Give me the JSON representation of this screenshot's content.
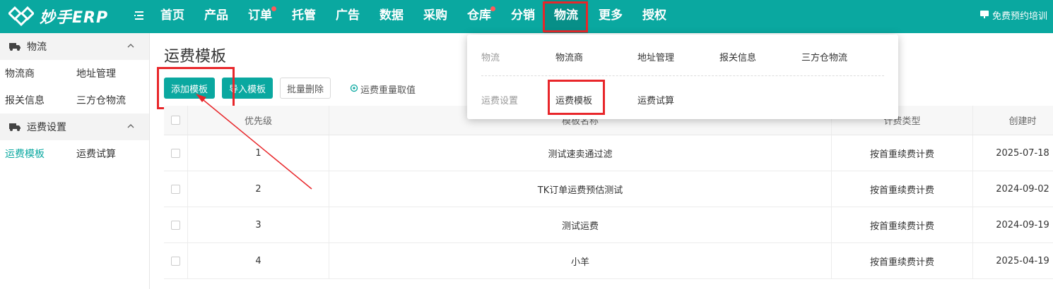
{
  "app": {
    "name": "妙手ERP"
  },
  "nav": {
    "items": [
      {
        "label": "首页",
        "dot": false
      },
      {
        "label": "产品",
        "dot": false
      },
      {
        "label": "订单",
        "dot": true
      },
      {
        "label": "托管",
        "dot": false
      },
      {
        "label": "广告",
        "dot": false
      },
      {
        "label": "数据",
        "dot": false
      },
      {
        "label": "采购",
        "dot": false
      },
      {
        "label": "仓库",
        "dot": true
      },
      {
        "label": "分销",
        "dot": false
      },
      {
        "label": "物流",
        "dot": false,
        "active": true
      },
      {
        "label": "更多",
        "dot": false
      },
      {
        "label": "授权",
        "dot": false
      }
    ],
    "training": "免费预约培训"
  },
  "sidebar": {
    "group1": {
      "label": "物流",
      "items": [
        "物流商",
        "地址管理",
        "报关信息",
        "三方仓物流"
      ]
    },
    "group2": {
      "label": "运费设置",
      "items": [
        "运费模板",
        "运费试算"
      ]
    }
  },
  "page": {
    "title": "运费模板",
    "buttons": {
      "add": "添加模板",
      "import": "导入模板",
      "batch_delete": "批量删除",
      "weight_rule": "运费重量取值"
    }
  },
  "table": {
    "headers": {
      "priority": "优先级",
      "name": "模板名称",
      "type": "计费类型",
      "created": "创建时"
    },
    "rows": [
      {
        "priority": "1",
        "name": "测试速卖通过滤",
        "type": "按首重续费计费",
        "created": "2025-07-18"
      },
      {
        "priority": "2",
        "name": "TK订单运费预估测试",
        "type": "按首重续费计费",
        "created": "2024-09-02"
      },
      {
        "priority": "3",
        "name": "测试运费",
        "type": "按首重续费计费",
        "created": "2024-09-19"
      },
      {
        "priority": "4",
        "name": "小羊",
        "type": "按首重续费计费",
        "created": "2025-04-19"
      }
    ]
  },
  "dropdown": {
    "row1": {
      "category": "物流",
      "items": [
        "物流商",
        "地址管理",
        "报关信息",
        "三方仓物流"
      ]
    },
    "row2": {
      "category": "运费设置",
      "items": [
        "运费模板",
        "运费试算"
      ]
    }
  },
  "colors": {
    "brand": "#0aa8a0",
    "highlight": "#e8262a"
  }
}
